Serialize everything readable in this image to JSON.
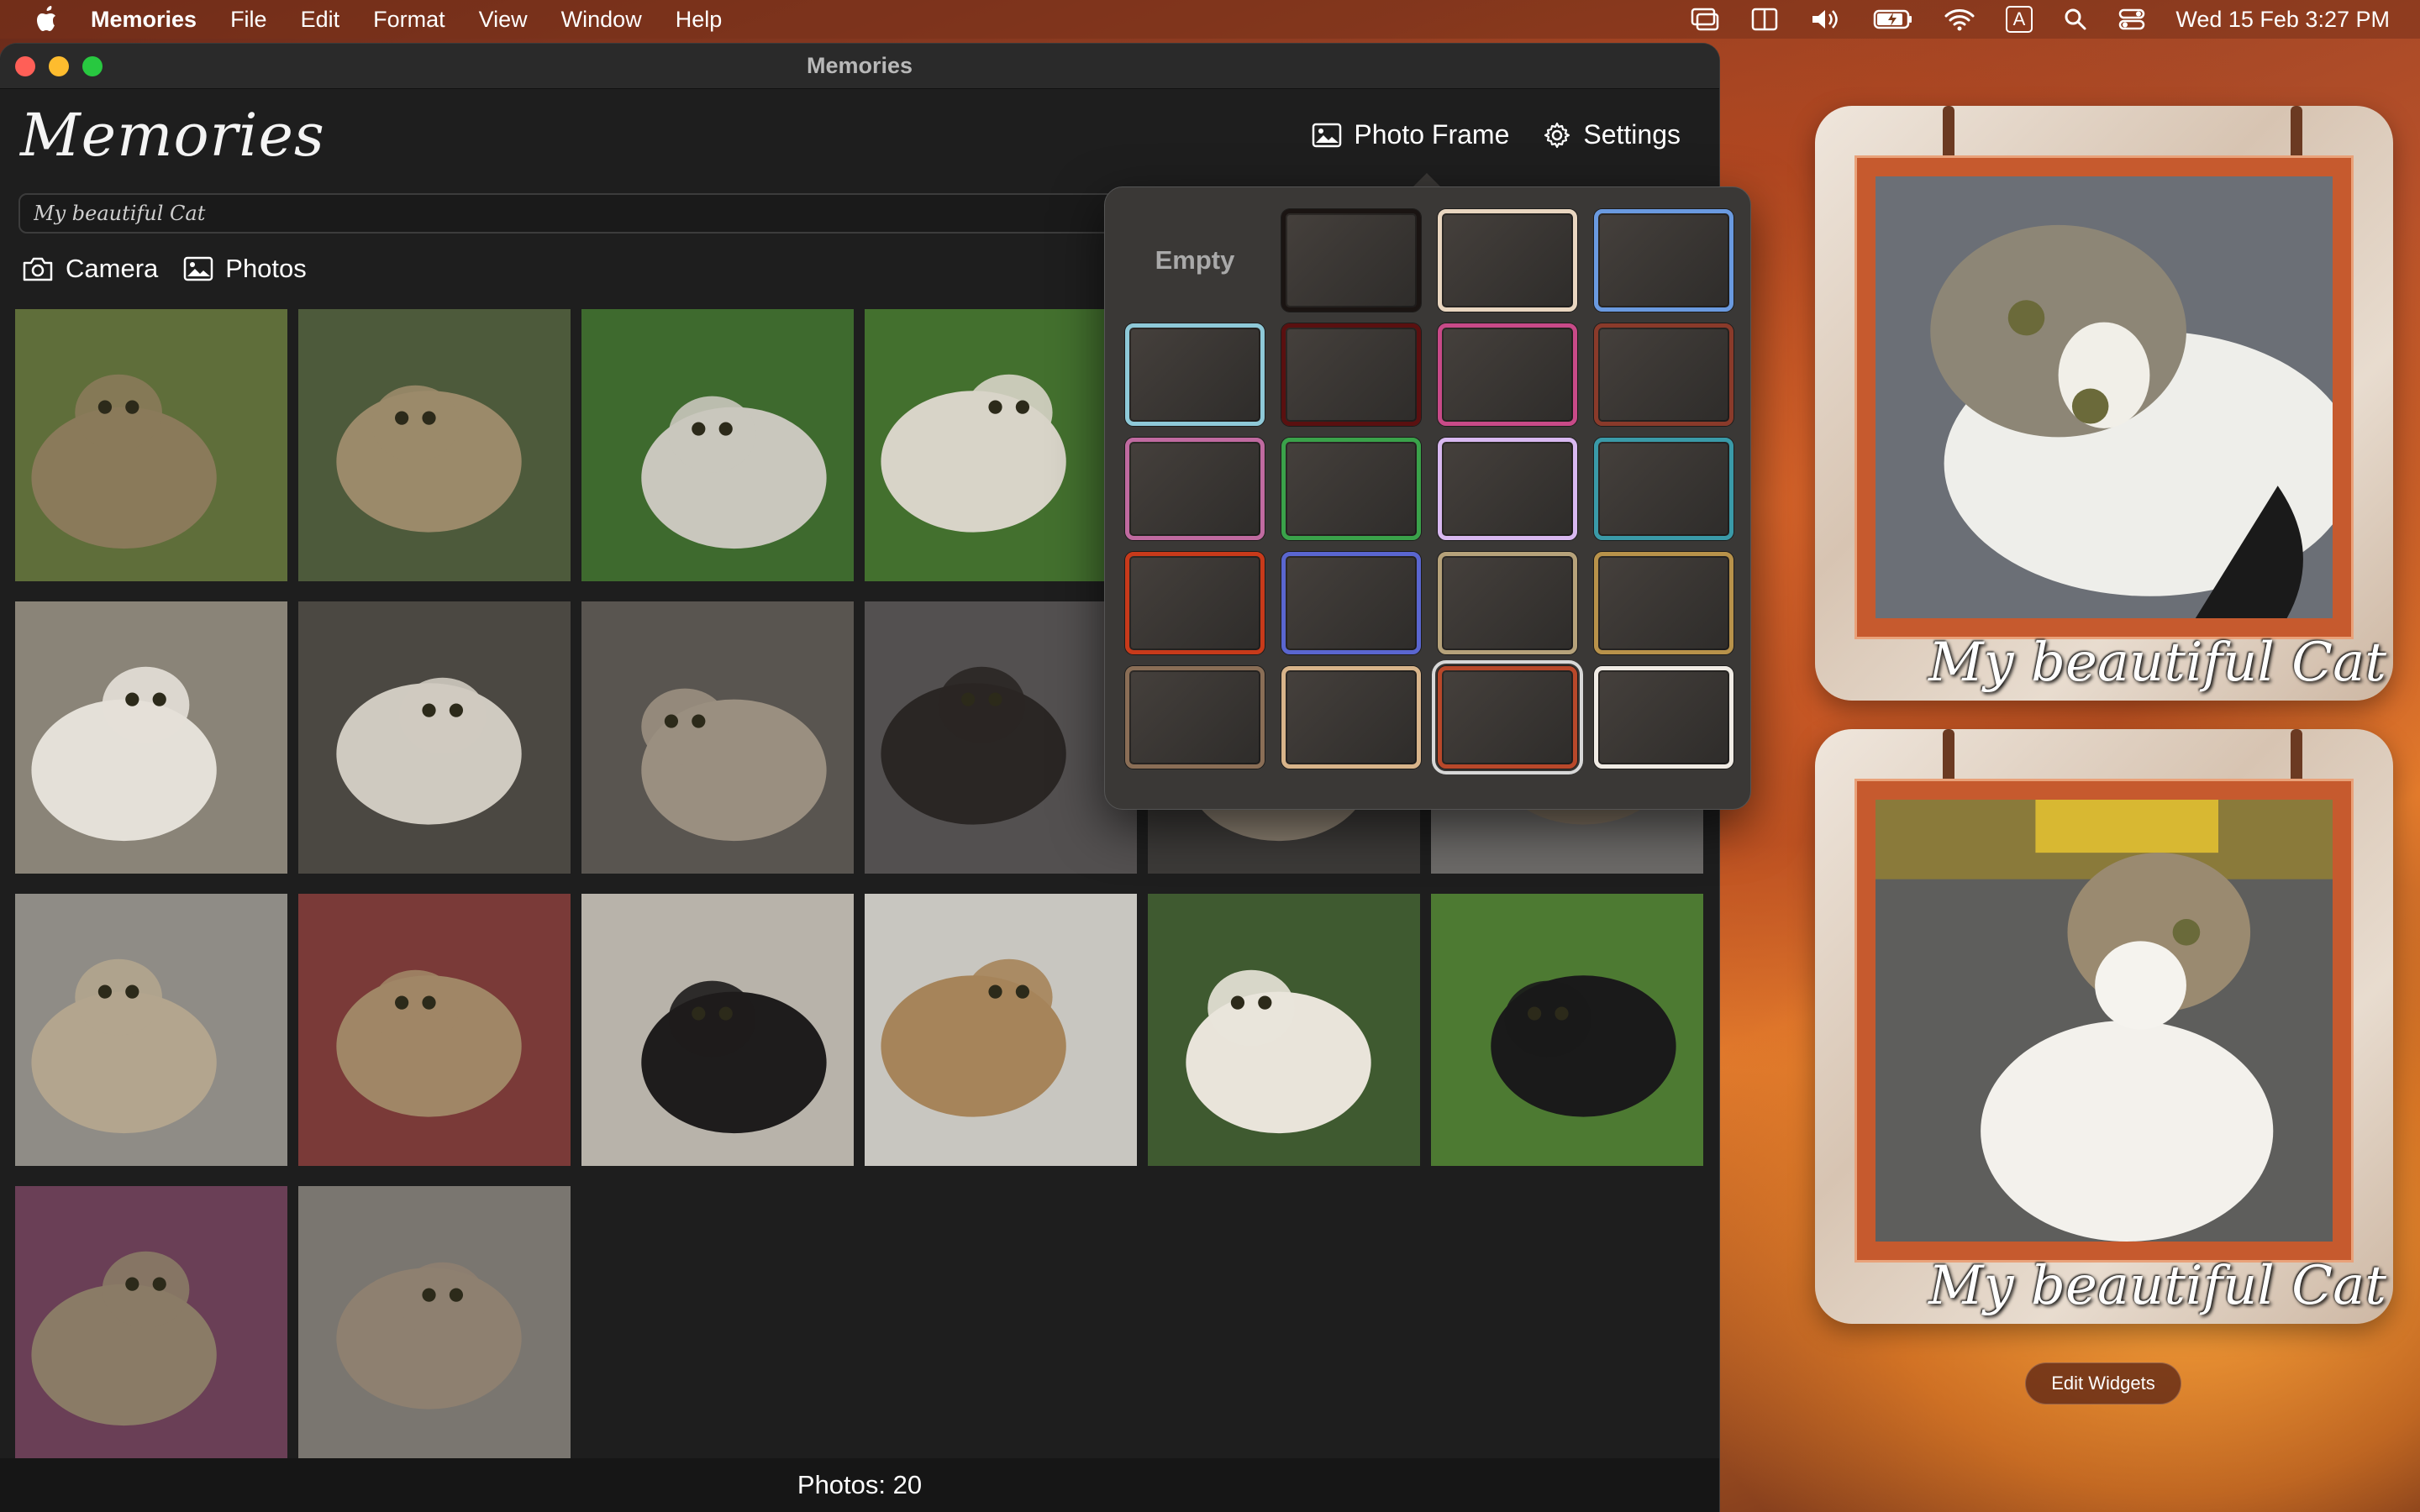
{
  "menubar": {
    "app_name": "Memories",
    "items": [
      "File",
      "Edit",
      "Format",
      "View",
      "Window",
      "Help"
    ],
    "input_indicator": "A",
    "clock": "Wed 15 Feb  3:27 PM"
  },
  "window": {
    "title": "Memories",
    "app_title": "Memories",
    "photo_frame_label": "Photo Frame",
    "settings_label": "Settings",
    "caption_value": "My beautiful Cat",
    "camera_label": "Camera",
    "photos_label": "Photos",
    "status": "Photos: 20"
  },
  "thumbnails": [
    {
      "bg": "#5f6e3a",
      "fg": "#8a7a5a"
    },
    {
      "bg": "#4d5a3b",
      "fg": "#9b8a6a"
    },
    {
      "bg": "#3e6a2e",
      "fg": "#c9c7bd"
    },
    {
      "bg": "#43702e",
      "fg": "#d8d4c8"
    },
    {
      "bg": "#6b5a3a",
      "fg": "#9a8c70"
    },
    {
      "bg": "#58564f",
      "fg": "#cfc9bd"
    },
    {
      "bg": "#8a8478",
      "fg": "#e4e0d8"
    },
    {
      "bg": "#4b4842",
      "fg": "#cfcac0"
    },
    {
      "bg": "#595550",
      "fg": "#9a8f80"
    },
    {
      "bg": "#535050",
      "fg": "#2a2624"
    },
    {
      "bg": "#3c3a38",
      "fg": "#8a7f70"
    },
    {
      "bg": "#6c6a68",
      "fg": "#7d7060"
    },
    {
      "bg": "#8f8c86",
      "fg": "#b3a58e"
    },
    {
      "bg": "#7a3a38",
      "fg": "#a08666"
    },
    {
      "bg": "#b8b3aa",
      "fg": "#1e1c1c"
    },
    {
      "bg": "#c8c6c0",
      "fg": "#a6845a"
    },
    {
      "bg": "#3f5a30",
      "fg": "#e9e4da"
    },
    {
      "bg": "#4d7a32",
      "fg": "#1a1a1a"
    },
    {
      "bg": "#6a3f56",
      "fg": "#8a7b66"
    },
    {
      "bg": "#7a7670",
      "fg": "#8e8070"
    }
  ],
  "frames": {
    "empty_label": "Empty",
    "borders": [
      "#1a1412",
      "#e9d6c0",
      "#6a9ae0",
      "#8ec9d8",
      "#5a1010",
      "#c84a88",
      "#8a3a2a",
      "#c06aa0",
      "#3aa24a",
      "#d8b8f0",
      "#3a9aa8",
      "#c83a1a",
      "#5a66d0",
      "#b6a27a",
      "#b8924a",
      "#8a6e56",
      "#d8b48a",
      "#b8482a",
      "#f0ebe4"
    ],
    "selected_index": 17
  },
  "widgets": [
    {
      "caption": "My beautiful Cat"
    },
    {
      "caption": "My beautiful Cat"
    }
  ],
  "edit_widgets_label": "Edit Widgets"
}
